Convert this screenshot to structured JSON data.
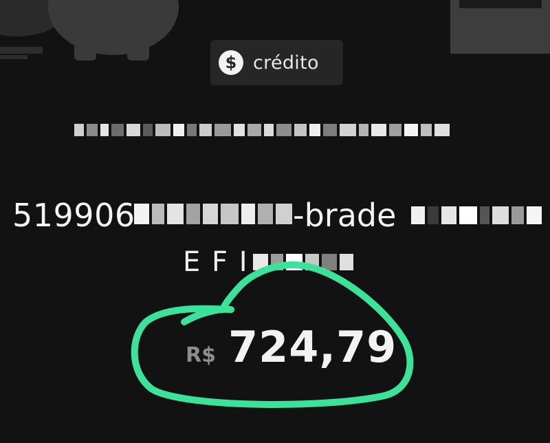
{
  "chip": {
    "icon": "dollar-circle-icon",
    "label": "crédito"
  },
  "transaction": {
    "description_visible_start": "519906",
    "description_visible_mid": "-brade",
    "description_second_line_visible": "E F I"
  },
  "amount": {
    "currency": "R$",
    "value": "724,79"
  },
  "colors": {
    "background": "#121212",
    "chip_background": "#262626",
    "annotation_green": "#3be39a"
  }
}
